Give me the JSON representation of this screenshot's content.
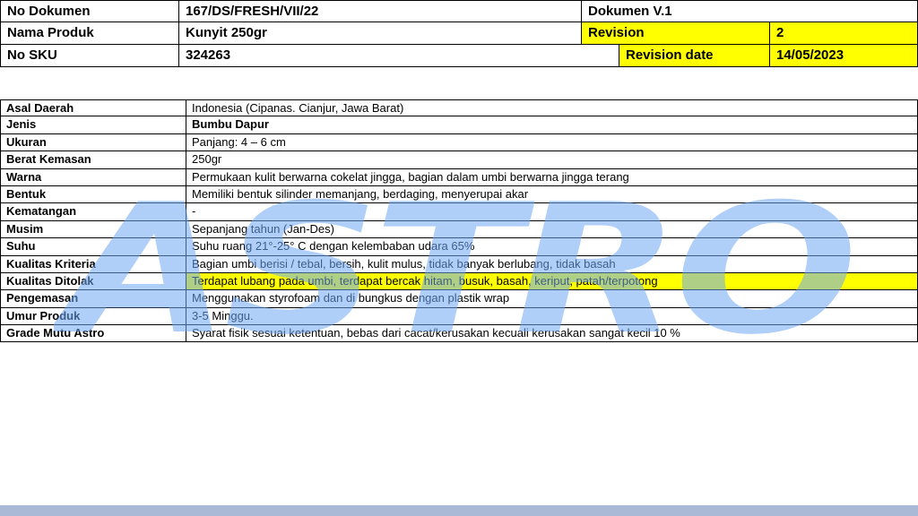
{
  "header": {
    "no_dokumen_label": "No Dokumen",
    "no_dokumen_value": "167/DS/FRESH/VII/22",
    "dokumen_version": "Dokumen V.1",
    "nama_produk_label": "Nama Produk",
    "nama_produk_value": "Kunyit 250gr",
    "revision_label": "Revision",
    "revision_value": "2",
    "no_sku_label": "No SKU",
    "no_sku_value": "324263",
    "revision_date_label": "Revision date",
    "revision_date_value": "14/05/2023"
  },
  "spec": {
    "rows": [
      {
        "label": "Asal Daerah",
        "value": "Indonesia (Cipanas. Cianjur, Jawa Barat)"
      },
      {
        "label": "Jenis",
        "value": "Bumbu Dapur"
      },
      {
        "label": "Ukuran",
        "value": "Panjang: 4 – 6 cm"
      },
      {
        "label": "Berat Kemasan",
        "value": "250gr"
      },
      {
        "label": "Warna",
        "value": "Permukaan kulit berwarna cokelat jingga, bagian dalam umbi berwarna jingga terang"
      },
      {
        "label": "Bentuk",
        "value": "Memiliki bentuk silinder memanjang, berdaging, menyerupai akar"
      },
      {
        "label": "Kematangan",
        "value": "-"
      },
      {
        "label": "Musim",
        "value": "Sepanjang tahun (Jan-Des)"
      },
      {
        "label": "Suhu",
        "value": "Suhu ruang 21°-25° C dengan kelembaban udara 65%"
      },
      {
        "label": "Kualitas Kriteria",
        "value": "Bagian umbi berisi / tebal, bersih, kulit mulus, tidak banyak berlubang, tidak basah"
      },
      {
        "label": "Kualitas Ditolak",
        "value": "Terdapat lubang pada umbi, terdapat bercak hitam, busuk, basah, keriput, patah/terpotong"
      },
      {
        "label": "Pengemasan",
        "value": "Menggunakan styrofoam dan di bungkus dengan plastik wrap"
      },
      {
        "label": "Umur Produk",
        "value": "3-5 Minggu."
      },
      {
        "label": "Grade Mutu Astro",
        "value": "Syarat fisik sesuai ketentuan, bebas dari cacat/kerusakan kecuali kerusakan sangat kecil 10 %"
      }
    ]
  },
  "watermark": {
    "text": "ASTRO"
  },
  "colors": {
    "highlight": "#ffff00",
    "watermark": "#6fa8f5",
    "footer_bar": "#a9b9d6"
  }
}
